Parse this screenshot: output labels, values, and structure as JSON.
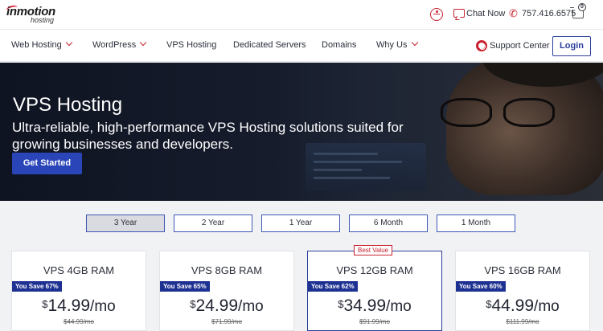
{
  "header": {
    "brand": "inmotion",
    "brand_sub": "hosting",
    "chat_label": "Chat Now",
    "phone": "757.416.6575",
    "cart_count": "0"
  },
  "nav": {
    "items": [
      {
        "label": "Web Hosting",
        "dropdown": true
      },
      {
        "label": "WordPress",
        "dropdown": true
      },
      {
        "label": "VPS Hosting",
        "dropdown": false
      },
      {
        "label": "Dedicated Servers",
        "dropdown": false
      },
      {
        "label": "Domains",
        "dropdown": false
      },
      {
        "label": "Why Us",
        "dropdown": true
      }
    ],
    "support_label": "Support Center",
    "login_label": "Login"
  },
  "hero": {
    "title": "VPS Hosting",
    "subtitle": "Ultra-reliable, high-performance VPS Hosting solutions suited for growing businesses and developers.",
    "cta_label": "Get Started"
  },
  "terms": {
    "items": [
      "3 Year",
      "2 Year",
      "1 Year",
      "6 Month",
      "1 Month"
    ],
    "selected": "3 Year"
  },
  "plans": [
    {
      "name": "VPS 4GB RAM",
      "savings": "You Save 67%",
      "currency": "$",
      "price": "14.99",
      "period": "/mo",
      "old_price": "44.99/mo",
      "badge": ""
    },
    {
      "name": "VPS 8GB RAM",
      "savings": "You Save 65%",
      "currency": "$",
      "price": "24.99",
      "period": "/mo",
      "old_price": "71.99/mo",
      "badge": ""
    },
    {
      "name": "VPS 12GB RAM",
      "savings": "You Save 62%",
      "currency": "$",
      "price": "34.99",
      "period": "/mo",
      "old_price": "91.99/mo",
      "badge": "Best Value"
    },
    {
      "name": "VPS 16GB RAM",
      "savings": "You Save 60%",
      "currency": "$",
      "price": "44.99",
      "period": "/mo",
      "old_price": "111.99/mo",
      "badge": ""
    }
  ],
  "colors": {
    "accent_red": "#c8202f",
    "brand_blue": "#2a3f9b",
    "cta_blue": "#2a45b8",
    "hero_bg": "#161c2c"
  }
}
